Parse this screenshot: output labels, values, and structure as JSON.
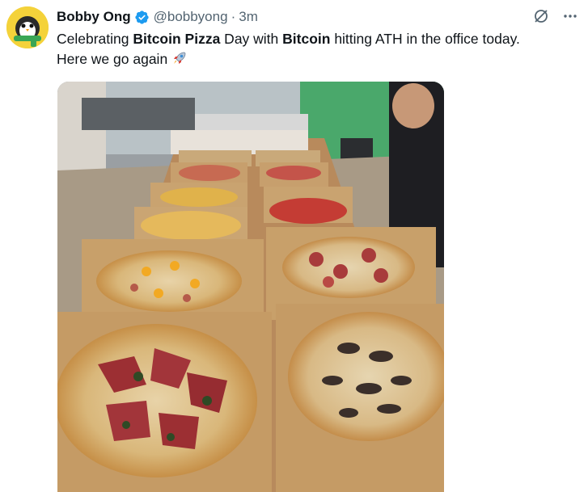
{
  "author": {
    "display_name": "Bobby Ong",
    "handle": "@bobbyong",
    "separator": "·",
    "time": "3m",
    "verified_icon": "verified-badge-icon",
    "avatar_icon": "penguin-avatar"
  },
  "header_icons": [
    "grok-icon",
    "more-icon"
  ],
  "tweet": {
    "part1": "Celebrating ",
    "bold1": "Bitcoin Pizza",
    "part2": " Day with ",
    "bold2": "Bitcoin",
    "part3": " hitting ATH in the office today.",
    "line2": "Here we go again",
    "emoji": "rocket-emoji"
  },
  "media": {
    "type": "photo",
    "icon": "photo-pizza-boxes-on-table"
  },
  "colors": {
    "text": "#0f1419",
    "secondary": "#536471",
    "verified": "#1d9bf0",
    "avatar_bg": "#f4d23a"
  }
}
